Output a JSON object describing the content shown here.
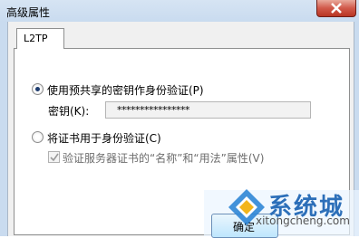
{
  "window": {
    "title": "高级属性"
  },
  "tabs": [
    {
      "label": "L2TP"
    }
  ],
  "options": {
    "psk_radio_label": "使用预共享的密钥作身份验证(P)",
    "key_label": "密钥(K):",
    "key_value": "****************",
    "cert_radio_label": "将证书用于身份验证(C)",
    "verify_checkbox_label": "验证服务器证书的“名称”和“用法”属性(V)",
    "psk_selected": true,
    "cert_selected": false,
    "verify_checked": true
  },
  "footer": {
    "ok_label": "确定"
  },
  "watermark": {
    "text": "系统城",
    "url": "xitongcheng.com"
  },
  "colors": {
    "titlebar": "#c9dbef",
    "close": "#c94536",
    "watermark": "#2c6fb9"
  }
}
